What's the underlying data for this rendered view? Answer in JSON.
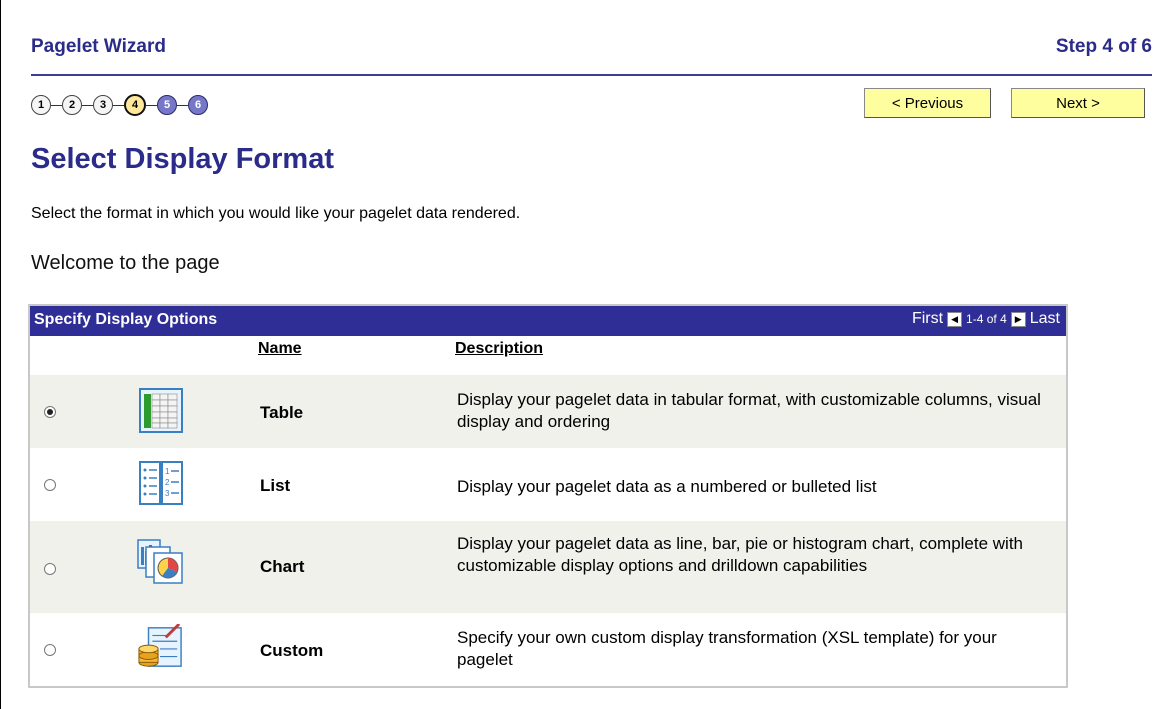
{
  "wizard": {
    "title": "Pagelet Wizard",
    "step_label": "Step 4 of 6",
    "steps": [
      "1",
      "2",
      "3",
      "4",
      "5",
      "6"
    ],
    "current_step": 4
  },
  "nav": {
    "previous_label": "< Previous",
    "next_label": "Next >"
  },
  "page": {
    "title": "Select Display Format",
    "instructions": "Select the format in which you would like your pagelet data rendered.",
    "welcome": "Welcome to the page"
  },
  "grid": {
    "title": "Specify Display Options",
    "pager": {
      "first": "First",
      "range": "1-4 of 4",
      "last": "Last"
    },
    "columns": {
      "name": "Name",
      "description": "Description"
    },
    "rows": [
      {
        "name": "Table",
        "description": "Display your pagelet data in tabular format, with customizable columns, visual display and ordering",
        "selected": true,
        "icon": "table-icon"
      },
      {
        "name": "List",
        "description": "Display your pagelet data as a numbered or bulleted list",
        "selected": false,
        "icon": "list-icon"
      },
      {
        "name": "Chart",
        "description": "Display your pagelet data as line, bar, pie or histogram chart, complete with customizable display options and drilldown capabilities",
        "selected": false,
        "icon": "chart-icon"
      },
      {
        "name": "Custom",
        "description": "Specify your own custom display transformation (XSL template) for your pagelet",
        "selected": false,
        "icon": "custom-icon"
      }
    ]
  },
  "colors": {
    "brand": "#2b2b8a",
    "header_bg": "#2e2e96",
    "button_bg": "#fffe9e",
    "current_step": "#ffe89a",
    "future_step": "#7777c7"
  }
}
